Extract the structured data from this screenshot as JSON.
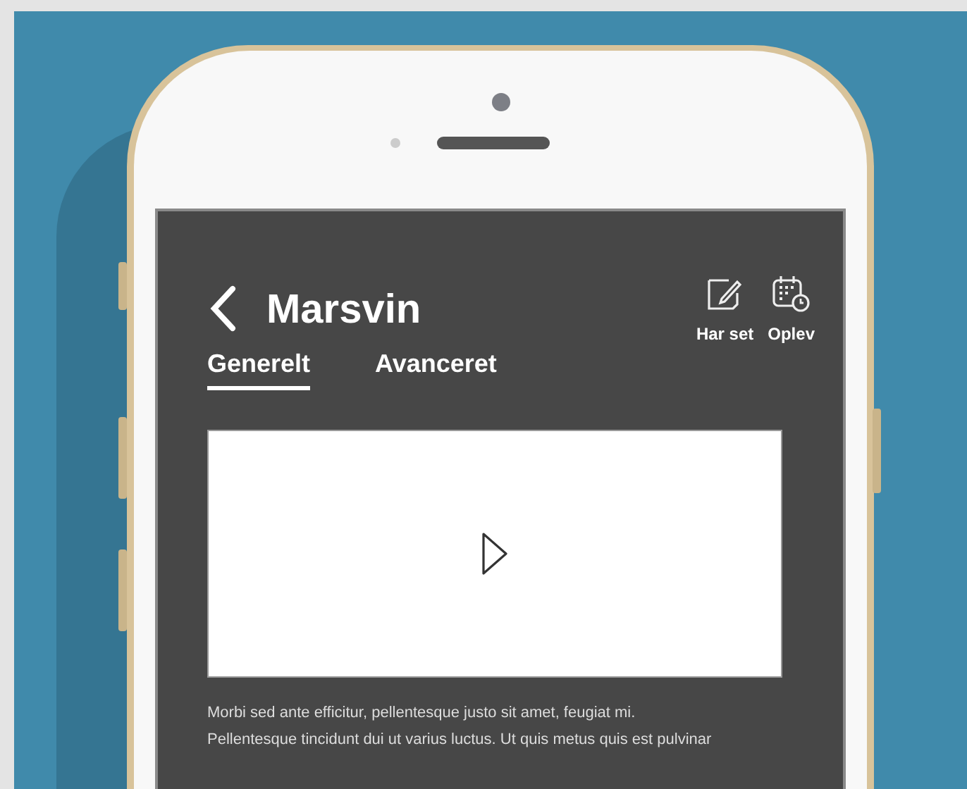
{
  "screen": {
    "title": "Marsvin",
    "actions": [
      {
        "kind": "note",
        "label": "Har set"
      },
      {
        "kind": "calendar",
        "label": "Oplev"
      }
    ],
    "tabs": [
      {
        "label": "Generelt",
        "selected": true
      },
      {
        "label": "Avanceret",
        "selected": false
      }
    ],
    "video": {
      "kind": "video"
    },
    "description_lines": [
      "Morbi sed ante efficitur, pellentesque justo sit amet, feugiat mi.",
      "Pellentesque tincidunt dui ut varius luctus. Ut quis metus quis est pulvinar"
    ]
  }
}
